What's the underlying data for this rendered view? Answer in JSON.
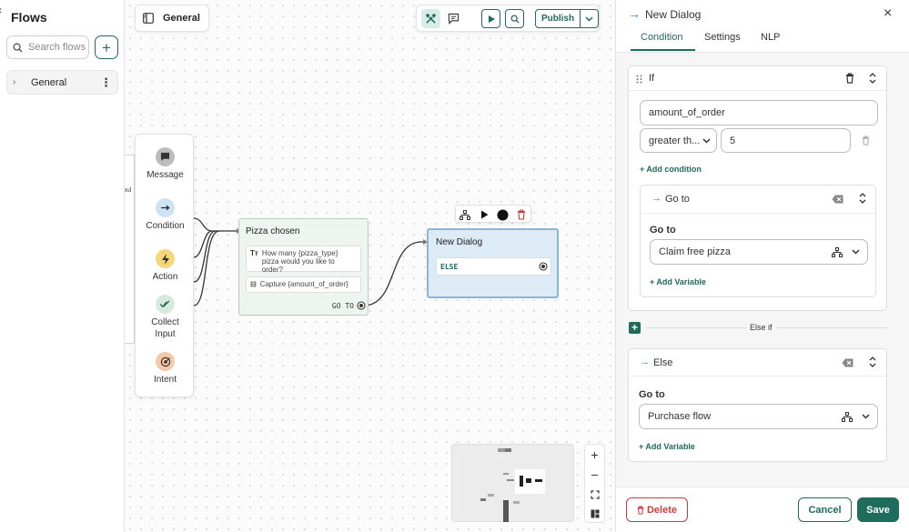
{
  "sidebar": {
    "back_glyph": "‹",
    "title": "Flows",
    "search_placeholder": "Search flows",
    "add_label": "+",
    "flows": [
      {
        "label": "General",
        "expand_glyph": "›",
        "menu_glyph": "⋮"
      }
    ]
  },
  "canvas": {
    "active_flow": "General",
    "toolbar": {
      "publish_label": "Publish",
      "icons": [
        "build-tools-icon",
        "chat-bubble-icon",
        "play-icon",
        "search-icon",
        "chevron-down-icon"
      ]
    },
    "left_stub_text": "oul",
    "palette": [
      {
        "label": "Message",
        "icon": "message-icon",
        "color": "#bdbdbd"
      },
      {
        "label": "Condition",
        "icon": "arrow-right-icon",
        "color": "#cfe3f6"
      },
      {
        "label": "Action",
        "icon": "lightning-icon",
        "color": "#f6d87a"
      },
      {
        "label": "Collect Input",
        "icon": "double-check-icon",
        "color": "#d8eadb"
      },
      {
        "label": "Intent",
        "icon": "target-icon",
        "color": "#f3c9a8"
      }
    ],
    "nodes": {
      "pizza": {
        "title": "Pizza chosen",
        "rows": [
          {
            "icon_text": "Tт",
            "text": "How many {pizza_type} pizza would you like to order?"
          },
          {
            "icon_text": "⊟",
            "text": "Capture {amount_of_order}"
          }
        ],
        "goto_label": "GO TO"
      },
      "dialog": {
        "title": "New Dialog",
        "else_label": "ELSE"
      }
    },
    "zoom": {
      "in": "+",
      "out": "−"
    }
  },
  "panel": {
    "header_arrow": "→",
    "title": "New Dialog",
    "close_glyph": "×",
    "tabs": [
      "Condition",
      "Settings",
      "NLP"
    ],
    "active_tab": "Condition",
    "if_block": {
      "label": "If",
      "variable": "amount_of_order",
      "operator": "greater th...",
      "value": "5",
      "add_condition": "+ Add condition",
      "goto": {
        "arrow": "→",
        "header": "Go to",
        "label": "Go to",
        "target": "Claim free pizza",
        "add_variable": "+ Add Variable"
      }
    },
    "else_if_label": "Else if",
    "else_block": {
      "arrow": "→",
      "label": "Else",
      "goto_label": "Go to",
      "target": "Purchase flow",
      "add_variable": "+ Add Variable"
    },
    "footer": {
      "delete_label": "Delete",
      "cancel_label": "Cancel",
      "save_label": "Save"
    }
  },
  "colors": {
    "accent": "#1f6b5c",
    "danger": "#d23a3a",
    "selected_node": "#dcebf6",
    "info": "#3a86d6"
  }
}
